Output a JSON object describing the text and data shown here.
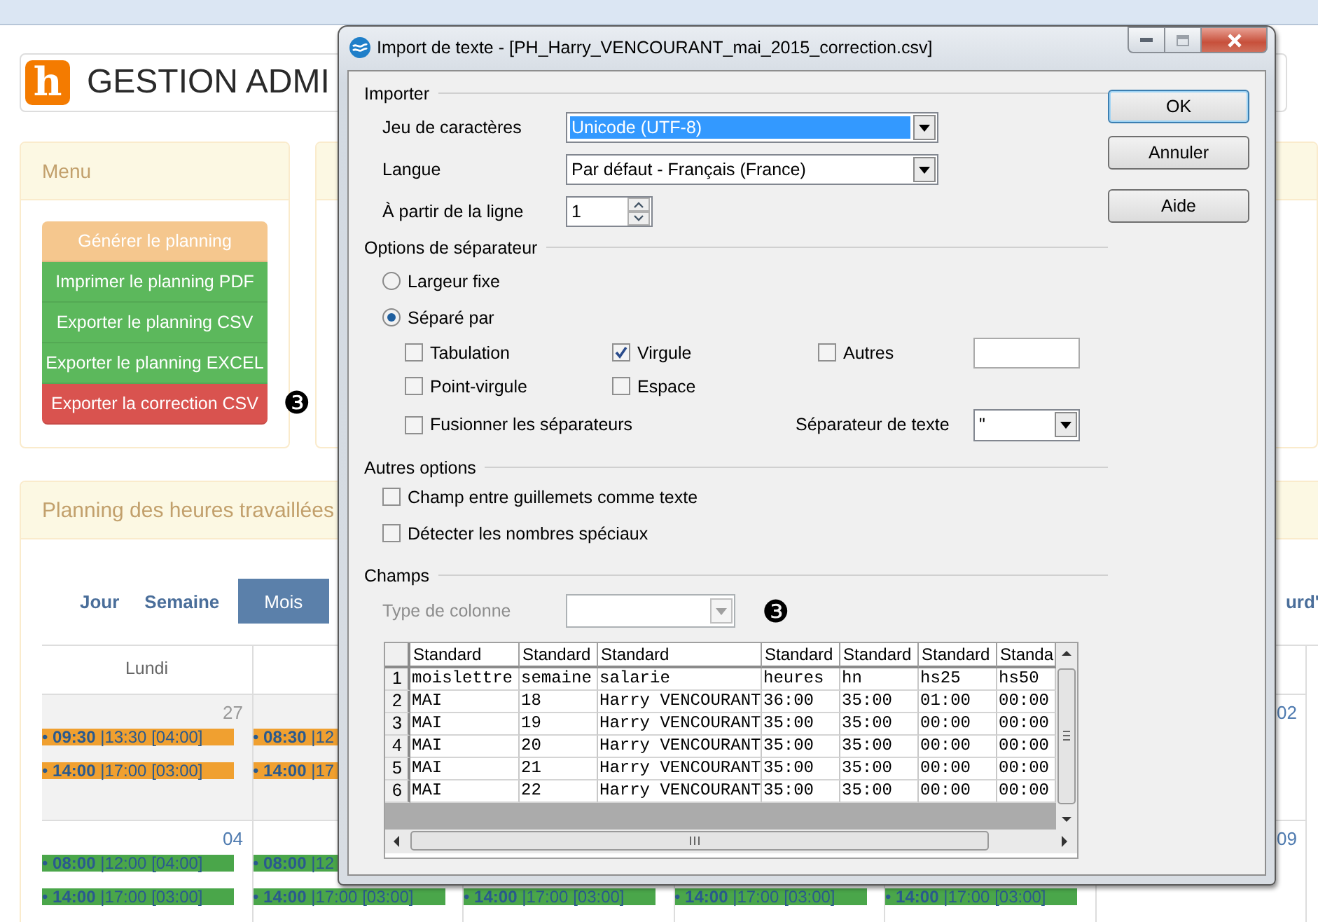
{
  "header": {
    "logo": "h",
    "title": "GESTION ADMI"
  },
  "menu": {
    "title": "Menu",
    "buttons": [
      {
        "label": "Générer le planning",
        "kind": "warning"
      },
      {
        "label": "Imprimer le planning PDF",
        "kind": "success"
      },
      {
        "label": "Exporter le planning CSV",
        "kind": "success"
      },
      {
        "label": "Exporter le planning EXCEL",
        "kind": "success"
      },
      {
        "label": "Exporter la correction CSV",
        "kind": "danger"
      }
    ]
  },
  "planning": {
    "title": "Planning des heures travaillées",
    "views": [
      {
        "label": "Jour",
        "selected": false
      },
      {
        "label": "Semaine",
        "selected": false
      },
      {
        "label": "Mois",
        "selected": true
      }
    ],
    "today_label": "urd'",
    "weekdays": [
      "Lundi"
    ],
    "weeks": [
      {
        "days": [
          {
            "number": "27",
            "outside_month": true,
            "events": [
              {
                "text": "• **09:30** |13:30 [04:00]",
                "color": "#f0a030"
              },
              {
                "text": "• **14:00** |17:00 [03:00]",
                "color": "#f0a030"
              }
            ]
          },
          {
            "outside_month": true,
            "events": [
              {
                "text": "• **08:30** |12",
                "color": "#f0a030"
              },
              {
                "text": "• **14:00** |17",
                "color": "#f0a030"
              }
            ]
          }
        ],
        "last_day": {
          "number": "02",
          "outside_month": false
        }
      },
      {
        "days": [
          {
            "number": "04",
            "outside_month": false,
            "events": [
              {
                "text": "• **08:00** |12:00 [04:00]",
                "color": "#4aa64a"
              },
              {
                "text": "• **14:00** |17:00 [03:00]",
                "color": "#4aa64a"
              }
            ]
          },
          {
            "events": [
              {
                "text": "• **08:00** |12",
                "color": "#4aa64a"
              },
              {
                "text": "• **14:00** |17:00 [03:00]",
                "color": "#4aa64a"
              }
            ]
          },
          {
            "events": [
              {
                "text": "• **14:00** |17:00 [03:00]",
                "color": "#4aa64a"
              }
            ]
          },
          {
            "events": [
              {
                "text": "• **14:00** |17:00 [03:00]",
                "color": "#4aa64a"
              }
            ]
          },
          {
            "events": [
              {
                "text": "• **14:00** |17:00 [03:00]",
                "color": "#4aa64a"
              }
            ]
          }
        ],
        "last_day": {
          "number": "09",
          "outside_month": false
        }
      }
    ]
  },
  "dialog": {
    "title": "Import de texte - [PH_Harry_VENCOURANT_mai_2015_correction.csv]",
    "import": {
      "heading": "Importer",
      "charset": {
        "label": "Jeu de caractères",
        "value": "Unicode (UTF-8)",
        "highlighted": true
      },
      "language": {
        "label": "Langue",
        "value": "Par défaut - Français (France)",
        "highlighted": false
      },
      "from_line": {
        "label": "À partir de la ligne",
        "value": "1"
      }
    },
    "separator_options": {
      "heading": "Options de séparateur",
      "modes": [
        {
          "label": "Largeur fixe",
          "selected": false
        },
        {
          "label": "Séparé par",
          "selected": true
        }
      ],
      "separators": [
        {
          "label": "Tabulation",
          "checked": false
        },
        {
          "label": "Virgule",
          "checked": true
        },
        {
          "label": "Autres",
          "checked": false
        },
        {
          "label": "Point-virgule",
          "checked": false
        },
        {
          "label": "Espace",
          "checked": false
        }
      ],
      "merge": {
        "label": "Fusionner les séparateurs",
        "checked": false
      },
      "text_separator": {
        "label": "Séparateur de texte",
        "value": "\""
      }
    },
    "other_options": {
      "heading": "Autres options",
      "options": [
        {
          "label": "Champ entre guillemets comme texte",
          "checked": false
        },
        {
          "label": "Détecter les nombres spéciaux",
          "checked": false
        }
      ]
    },
    "fields": {
      "heading": "Champs",
      "column_type": {
        "label": "Type de colonne",
        "disabled": true
      },
      "table": {
        "columns": [
          "Standard",
          "Standard",
          "Standard",
          "Standard",
          "Standard",
          "Standard",
          "Standa"
        ],
        "rows": [
          {
            "number": "1",
            "cells": [
              "moislettre",
              "semaine",
              "salarie",
              "heures",
              "hn",
              "hs25",
              "hs50"
            ]
          },
          {
            "number": "2",
            "cells": [
              "MAI",
              "18",
              "Harry VENCOURANT",
              "36:00",
              "35:00",
              "01:00",
              "00:00"
            ]
          },
          {
            "number": "3",
            "cells": [
              "MAI",
              "19",
              "Harry VENCOURANT",
              "35:00",
              "35:00",
              "00:00",
              "00:00"
            ]
          },
          {
            "number": "4",
            "cells": [
              "MAI",
              "20",
              "Harry VENCOURANT",
              "35:00",
              "35:00",
              "00:00",
              "00:00"
            ]
          },
          {
            "number": "5",
            "cells": [
              "MAI",
              "21",
              "Harry VENCOURANT",
              "35:00",
              "35:00",
              "00:00",
              "00:00"
            ]
          },
          {
            "number": "6",
            "cells": [
              "MAI",
              "22",
              "Harry VENCOURANT",
              "35:00",
              "35:00",
              "00:00",
              "00:00"
            ]
          }
        ]
      }
    },
    "buttons": [
      {
        "label": "OK",
        "focused": true
      },
      {
        "label": "Annuler",
        "focused": false
      },
      {
        "label": "Aide",
        "focused": false
      }
    ]
  },
  "markers": [
    "❸",
    "❸"
  ]
}
